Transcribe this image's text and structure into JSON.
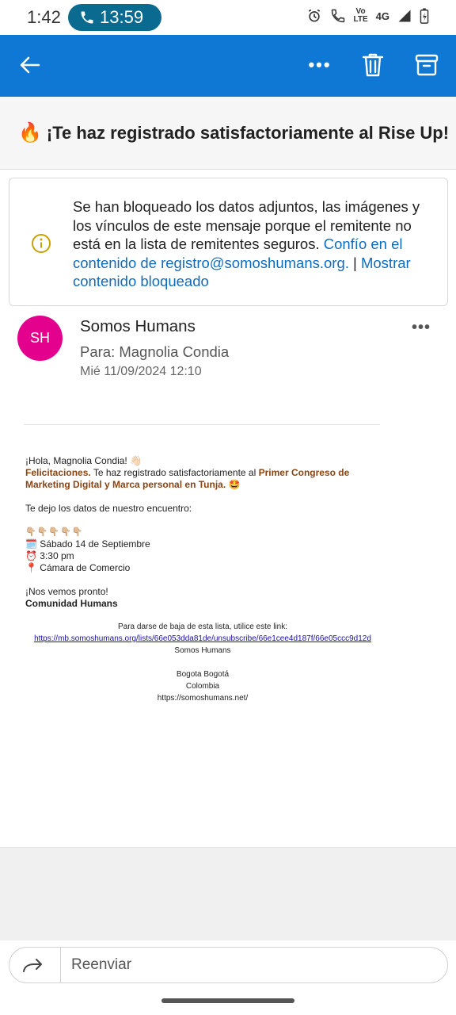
{
  "status_bar": {
    "time": "1:42",
    "call_duration": "13:59",
    "network": "4G",
    "volte_line1": "Vo",
    "volte_line2": "LTE"
  },
  "header": {
    "more_label": "•••",
    "back_icon": "arrow-left-icon",
    "delete_icon": "trash-icon",
    "archive_icon": "archive-icon"
  },
  "subject": {
    "emoji": "🔥",
    "text": "¡Te haz registrado satisfactoriamente al Rise Up!"
  },
  "banner": {
    "message": "Se han bloqueado los datos adjuntos, las imágenes y los vínculos de este mensaje porque el remitente no está en la lista de remitentes seguros.",
    "trust_link": "Confío en el contenido de registro@somoshumans.org.",
    "separator": "|",
    "show_link": "Mostrar contenido bloqueado"
  },
  "sender": {
    "initials": "SH",
    "name": "Somos Humans",
    "to": "Para: Magnolia Condia",
    "date": "Mié 11/09/2024 12:10",
    "more_label": "•••"
  },
  "email_body": {
    "greeting": "¡Hola, Magnolia Condia! 👋🏻",
    "congrats_word": "Felicitaciones.",
    "congrats_text": " Te haz registrado satisfactoriamente al ",
    "event_name": "Primer Congreso de Marketing Digital y Marca personal en Tunja.",
    "event_emoji": " 🤩",
    "intro": "Te dejo los datos de nuestro encuentro:",
    "pointing": "👇🏼👇🏼👇🏼👇🏼👇🏼",
    "date_line": "🗓️ Sábado 14 de Septiembre",
    "time_line": "⏰ 3:30 pm",
    "place_line": "📍 Cámara de Comercio",
    "closing": "¡Nos vemos pronto!",
    "signature": "Comunidad Humans"
  },
  "footer": {
    "unsubscribe_text": "Para darse de baja de esta lista, utilice este link:",
    "unsubscribe_url": "https://mb.somoshumans.org/lists/66e053dda81de/unsubscribe/66e1cee4d187f/66e05ccc9d12d",
    "org": "Somos Humans",
    "city": "Bogota Bogotá",
    "country": "Colombia",
    "website": "https://somoshumans.net/"
  },
  "reply_bar": {
    "label": "Reenviar"
  },
  "colors": {
    "header_blue": "#0f78d4",
    "avatar_pink": "#e3008c",
    "link_blue": "#0f6cbd",
    "call_pill": "#0b6a8f"
  }
}
